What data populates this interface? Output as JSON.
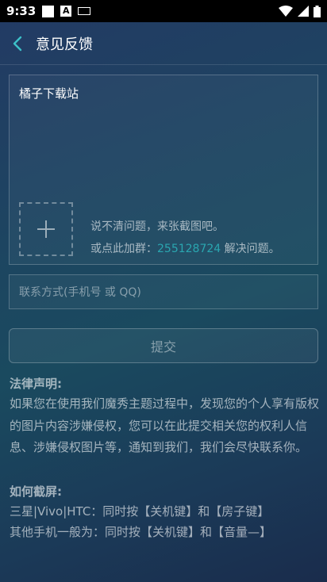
{
  "status_bar": {
    "time": "9:33",
    "notification_letter": "A"
  },
  "header": {
    "title": "意见反馈"
  },
  "feedback": {
    "text": "橘子下载站",
    "hint_line1": "说不清问题，来张截图吧。",
    "hint_line2_prefix": "或点此加群：",
    "qq_group": "255128724",
    "hint_line2_suffix": " 解决问题。"
  },
  "contact": {
    "placeholder": "联系方式(手机号 或 QQ)"
  },
  "submit": {
    "label": "提交"
  },
  "legal": {
    "title": "法律声明:",
    "body": "如果您在使用我们魔秀主题过程中，发现您的个人享有版权的图片内容涉嫌侵权，您可以在此提交相关您的权利人信息、涉嫌侵权图片等，通知到我们，我们会尽快联系你。"
  },
  "screenshot_help": {
    "title": "如何截屏:",
    "line1": "三星|Vivo|HTC：同时按【关机键】和【房子键】",
    "line2": "其他手机一般为：同时按【关机键】和【音量—】"
  },
  "colors": {
    "accent": "#2aa6b0",
    "background_top": "#233a64",
    "background_mid": "#1a4a5f"
  }
}
